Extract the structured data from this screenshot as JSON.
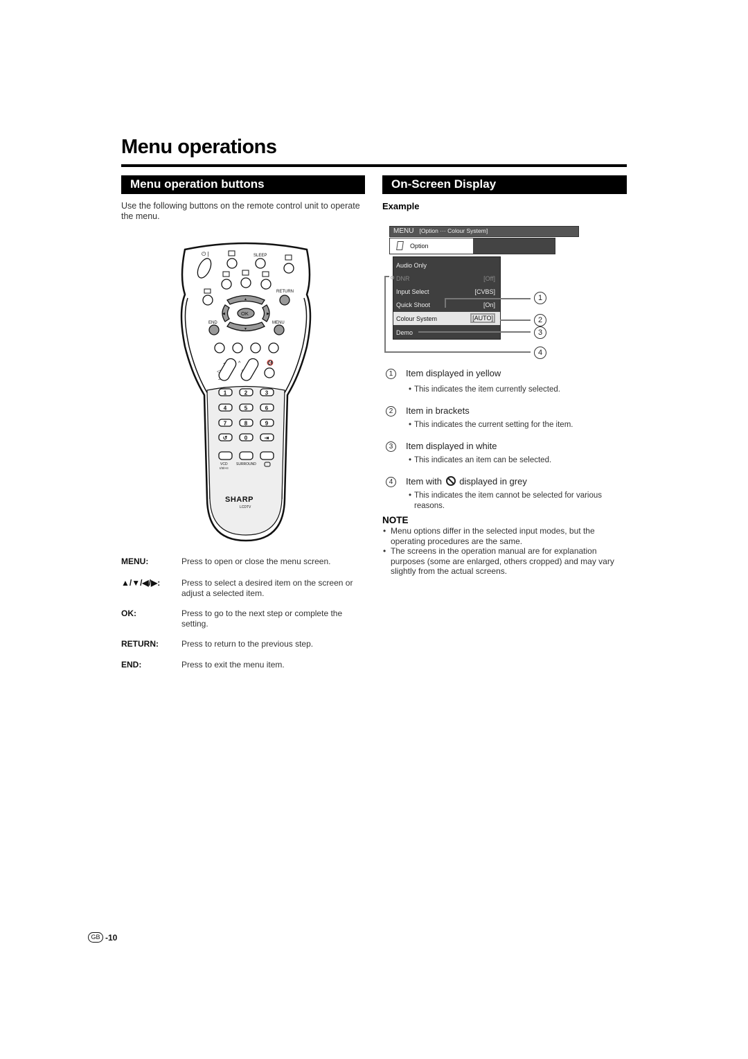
{
  "page": {
    "title": "Menu operations",
    "page_number": "-10",
    "region_badge": "GB"
  },
  "left": {
    "section_title": "Menu operation buttons",
    "intro": "Use the following buttons on the remote control unit to operate the menu.",
    "remote": {
      "brand": "SHARP",
      "model": "LCDTV",
      "labels": {
        "sleep": "SLEEP",
        "return": "RETURN",
        "end": "END",
        "menu": "MENU",
        "ok": "OK",
        "surround": "SURROUND",
        "vcd": "VCD",
        "plus": "+",
        "minus": "–",
        "p": "P"
      },
      "number_keys": [
        "1",
        "2",
        "3",
        "4",
        "5",
        "6",
        "7",
        "8",
        "9",
        "↺",
        "0",
        "⇥"
      ]
    },
    "keys": [
      {
        "name": "MENU:",
        "desc": "Press to open or close the menu screen."
      },
      {
        "name": "▲/▼/◀/▶:",
        "desc": "Press to select a desired item on the screen or adjust a selected item."
      },
      {
        "name": "OK:",
        "desc": "Press to go to the next step or complete the setting."
      },
      {
        "name": "RETURN:",
        "desc": "Press to return to the previous step."
      },
      {
        "name": "END:",
        "desc": "Press to exit the menu item."
      }
    ]
  },
  "right": {
    "section_title": "On-Screen Display",
    "example_label": "Example",
    "osd": {
      "header_menu": "MENU",
      "header_path": "[Option ··· Colour System]",
      "tab": "Option",
      "items": [
        {
          "label": "Audio Only",
          "value": "",
          "state": "normal"
        },
        {
          "label": "DNR",
          "value": "[Off]",
          "state": "disabled"
        },
        {
          "label": "Input Select",
          "value": "[CVBS]",
          "state": "normal"
        },
        {
          "label": "Quick Shoot",
          "value": "[On]",
          "state": "normal"
        },
        {
          "label": "Colour System",
          "value": "[AUTO]",
          "state": "selected"
        },
        {
          "label": "Demo",
          "value": "",
          "state": "normal"
        }
      ],
      "callouts": [
        "1",
        "2",
        "3",
        "4"
      ]
    },
    "legend": [
      {
        "num": "1",
        "title": "Item displayed in yellow",
        "desc": "This indicates the item currently selected."
      },
      {
        "num": "2",
        "title": "Item in brackets",
        "desc": "This indicates the current setting for the item."
      },
      {
        "num": "3",
        "title": "Item displayed in white",
        "desc": "This indicates an item can be selected."
      },
      {
        "num": "4",
        "title_before": "Item with",
        "title_after": "displayed in grey",
        "icon": "prohibited-icon",
        "desc": "This indicates the item cannot be selected for various reasons."
      }
    ],
    "note": {
      "title": "NOTE",
      "items": [
        "Menu options differ in the selected input modes, but the operating procedures are the same.",
        "The screens in the operation manual are for explanation purposes (some are enlarged, others cropped) and may vary slightly from the actual screens."
      ]
    }
  }
}
